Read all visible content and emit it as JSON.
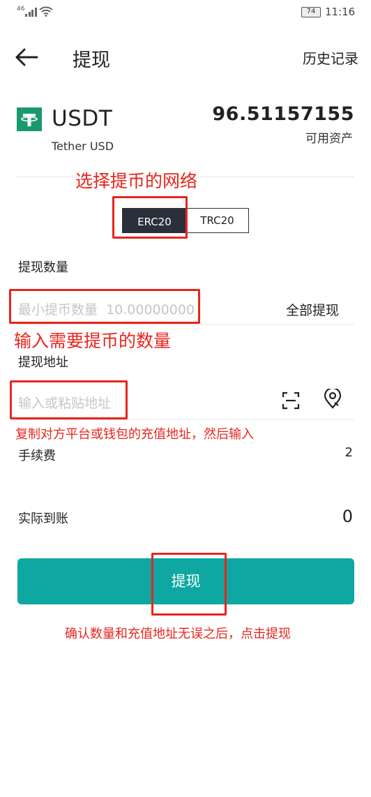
{
  "status_bar": {
    "network": "46",
    "battery": "74",
    "time": "11:16"
  },
  "header": {
    "title": "提现",
    "history": "历史记录"
  },
  "coin": {
    "symbol": "USDT",
    "name": "Tether USD",
    "balance": "96.51157155",
    "balance_label": "可用资产"
  },
  "network": {
    "annotation": "选择提币的网络",
    "options": [
      "ERC20",
      "TRC20"
    ],
    "selected": "ERC20"
  },
  "amount": {
    "label": "提现数量",
    "placeholder": "最小提币数量  10.00000000",
    "all_button": "全部提现",
    "annotation": "输入需要提币的数量"
  },
  "address": {
    "label": "提现地址",
    "placeholder": "输入或粘贴地址",
    "annotation": "复制对方平台或钱包的充值地址，然后输入"
  },
  "fee": {
    "label": "手续费",
    "value": "2"
  },
  "received": {
    "label": "实际到账",
    "value": "0"
  },
  "submit": {
    "label": "提现",
    "annotation": "确认数量和充值地址无误之后，点击提现"
  },
  "colors": {
    "accent": "#0fa7a1",
    "annotation": "#e8251c",
    "coin_logo": "#1a9a6c",
    "selected_chip": "#2b2f3b"
  },
  "icons": {
    "back": "arrow-left-icon",
    "scan": "scan-icon",
    "location": "location-pin-icon",
    "coin": "tether-logo-icon"
  }
}
